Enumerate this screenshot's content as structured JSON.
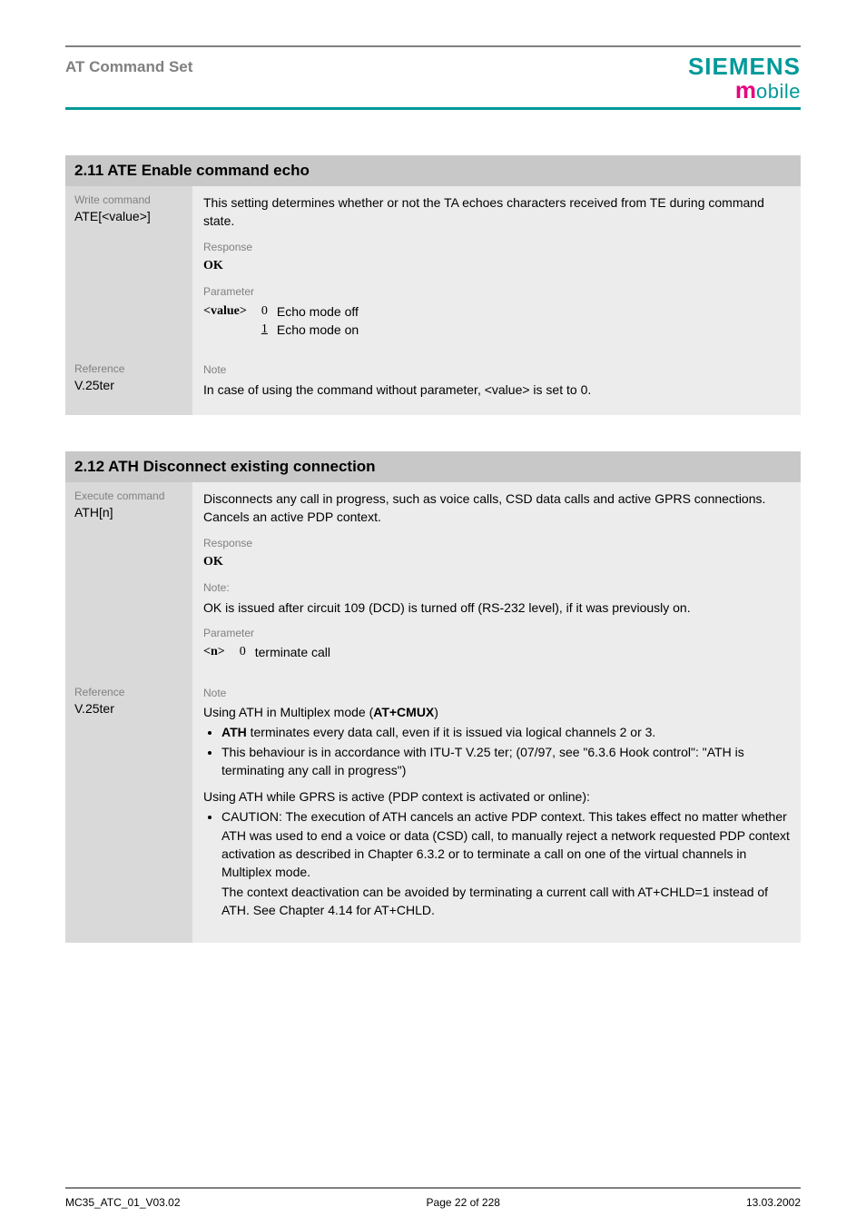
{
  "header": {
    "title": "AT Command Set",
    "logo_top": "SIEMENS",
    "logo_m": "m",
    "logo_rest": "obile"
  },
  "section1": {
    "heading": "2.11  ATE  Enable command echo",
    "left1_label": "Write command",
    "left1_value": "ATE[<value>]",
    "desc": "This setting determines whether or not the TA echoes characters received from TE during command state.",
    "response_label": "Response",
    "ok": "OK",
    "param_label": "Parameter",
    "param_key": "<value>",
    "param_rows": [
      {
        "num": "0",
        "desc": "Echo mode off",
        "underline": false
      },
      {
        "num": "1",
        "desc": "Echo mode on",
        "underline": true
      }
    ],
    "ref_label": "Reference",
    "ref_value": "V.25ter",
    "note_label": "Note",
    "note_text": "In case of using the command without parameter, <value> is set to 0."
  },
  "section2": {
    "heading": "2.12  ATH  Disconnect existing connection",
    "left1_label": "Execute command",
    "left1_value": "ATH[n]",
    "desc": "Disconnects any call in progress, such as voice calls, CSD data calls and active GPRS connections. Cancels an active PDP context.",
    "response_label": "Response",
    "ok": "OK",
    "note_label_inline": "Note:",
    "note_inline": "OK is issued after circuit 109 (DCD) is turned off (RS-232 level), if it was previously on.",
    "param_label": "Parameter",
    "param_key": "<n>",
    "param_rows": [
      {
        "num": "0",
        "desc": "terminate call",
        "underline": false
      }
    ],
    "ref_label": "Reference",
    "ref_value": "V.25ter",
    "note_label": "Note",
    "mux_intro": "Using ATH in Multiplex mode (",
    "mux_cmd": "AT+CMUX",
    "mux_intro_tail": ")",
    "mux_bullets": [
      "ATH terminates every data call, even if it is issued via logical channels 2 or 3.",
      "This behaviour is in accordance with ITU-T V.25 ter; (07/97, see \"6.3.6 Hook control\": \"ATH is terminating any call in progress\")"
    ],
    "gprs_intro": "Using ATH while GPRS is active (PDP context is activated or online):",
    "gprs_bullet": "CAUTION: The execution of ATH cancels an active PDP context. This takes effect no matter whether ATH was used to end a voice or data (CSD) call, to manually reject a network requested PDP context activation as described in Chapter 6.3.2 or to terminate a call on one of the virtual channels in Multiplex mode.",
    "gprs_tail1": "The context deactivation can be avoided by terminating a current call with AT+CHLD=1 instead of ATH. See Chapter 4.14 for AT+CHLD."
  },
  "footer": {
    "left": "MC35_ATC_01_V03.02",
    "center": "Page 22 of 228",
    "right": "13.03.2002"
  }
}
